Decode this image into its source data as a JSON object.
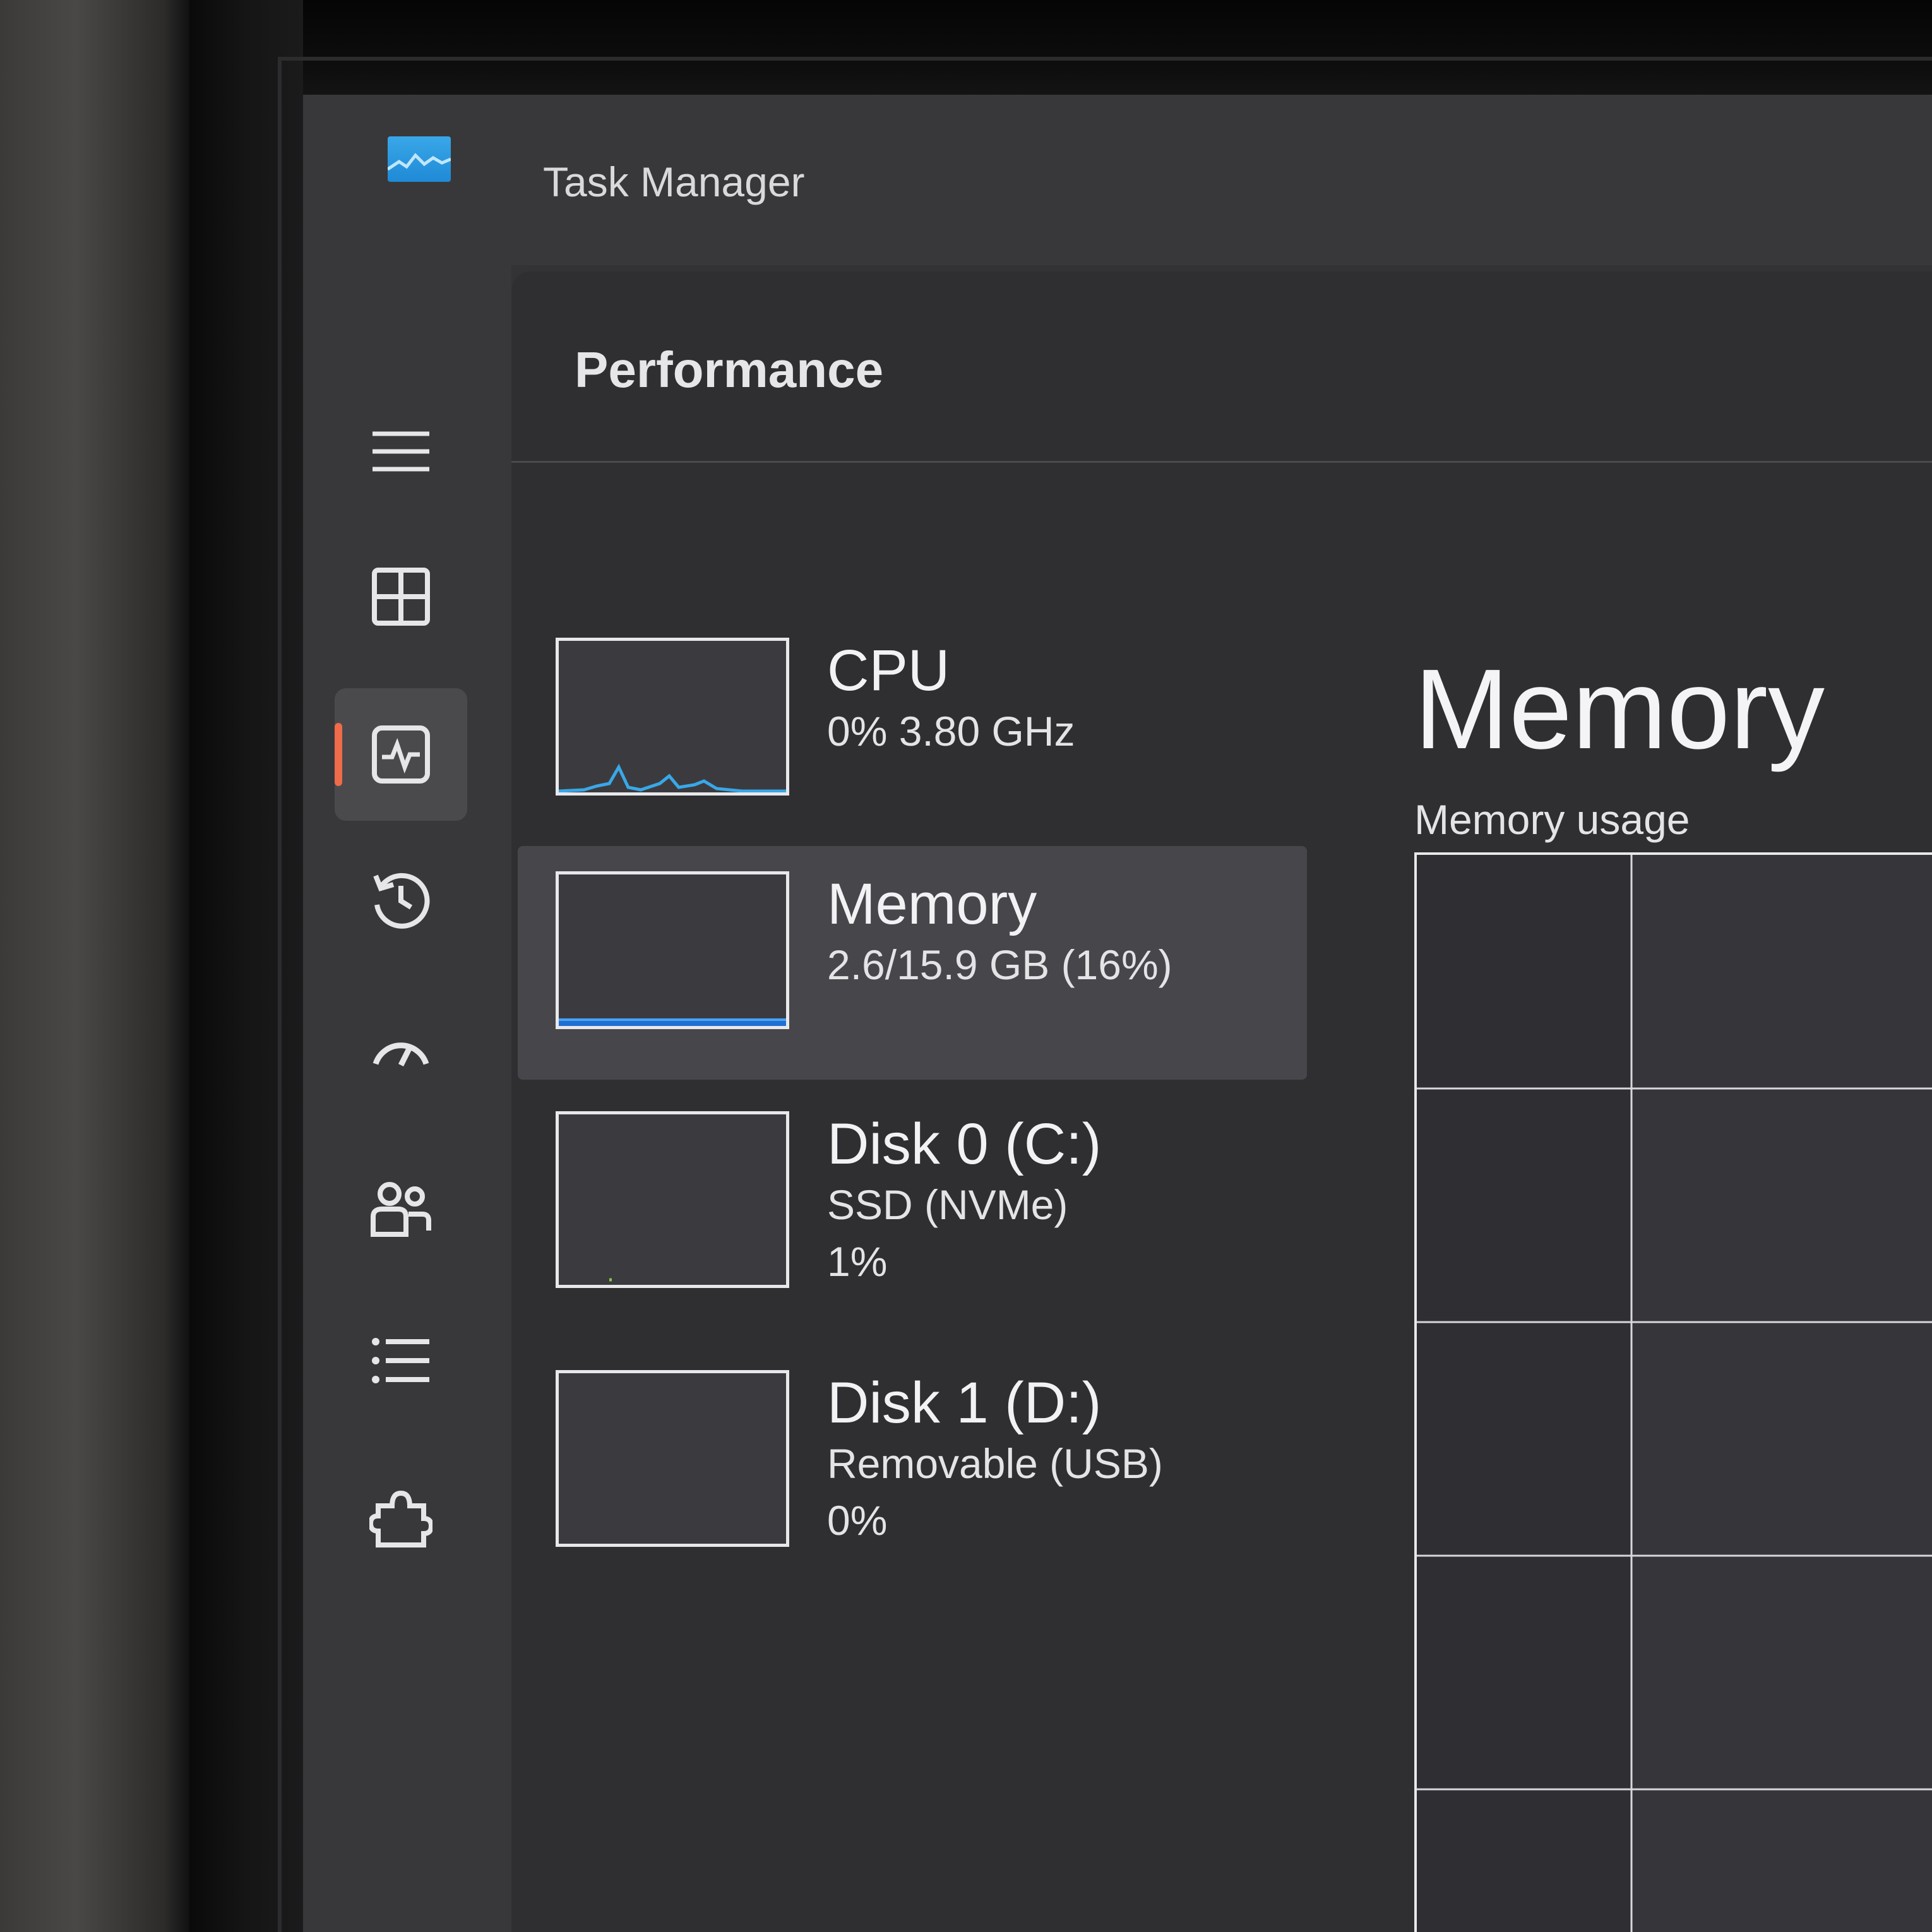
{
  "window": {
    "title": "Task Manager"
  },
  "nav": {
    "items": [
      {
        "id": "menu",
        "icon": "hamburger-icon",
        "selected": false
      },
      {
        "id": "processes",
        "icon": "processes-icon",
        "selected": false
      },
      {
        "id": "performance",
        "icon": "performance-icon",
        "selected": true
      },
      {
        "id": "app-history",
        "icon": "history-icon",
        "selected": false
      },
      {
        "id": "startup",
        "icon": "speedometer-icon",
        "selected": false
      },
      {
        "id": "users",
        "icon": "users-icon",
        "selected": false
      },
      {
        "id": "details",
        "icon": "list-icon",
        "selected": false
      },
      {
        "id": "services",
        "icon": "puzzle-icon",
        "selected": false
      }
    ]
  },
  "main": {
    "section_title": "Performance",
    "resources": [
      {
        "name": "CPU",
        "lines": [
          "0%  3.80 GHz"
        ],
        "selected": false
      },
      {
        "name": "Memory",
        "lines": [
          "2.6/15.9 GB (16%)"
        ],
        "usage_fraction": 0.16,
        "selected": true
      },
      {
        "name": "Disk 0 (C:)",
        "lines": [
          "SSD (NVMe)",
          "1%"
        ],
        "selected": false
      },
      {
        "name": "Disk 1 (D:)",
        "lines": [
          "Removable (USB)",
          "0%"
        ],
        "selected": false
      }
    ],
    "detail": {
      "title": "Memory",
      "subtitle": "Memory usage"
    }
  },
  "colors": {
    "accent_indicator": "#f06b4a",
    "memory_graph": "#1f6fd0",
    "cpu_graph": "#39a7e8"
  }
}
